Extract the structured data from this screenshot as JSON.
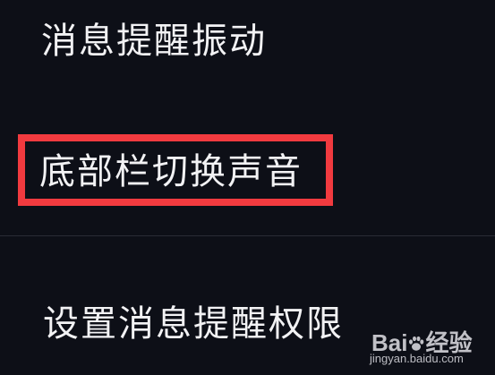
{
  "settings": {
    "items": [
      {
        "label": "消息提醒振动"
      },
      {
        "label": "底部栏切换声音"
      },
      {
        "label": "设置消息提醒权限"
      }
    ]
  },
  "highlight": {
    "color": "#f13a3f"
  },
  "watermark": {
    "brand_left": "Bai",
    "brand_right": "经验",
    "url": "jingyan.baidu.com"
  }
}
